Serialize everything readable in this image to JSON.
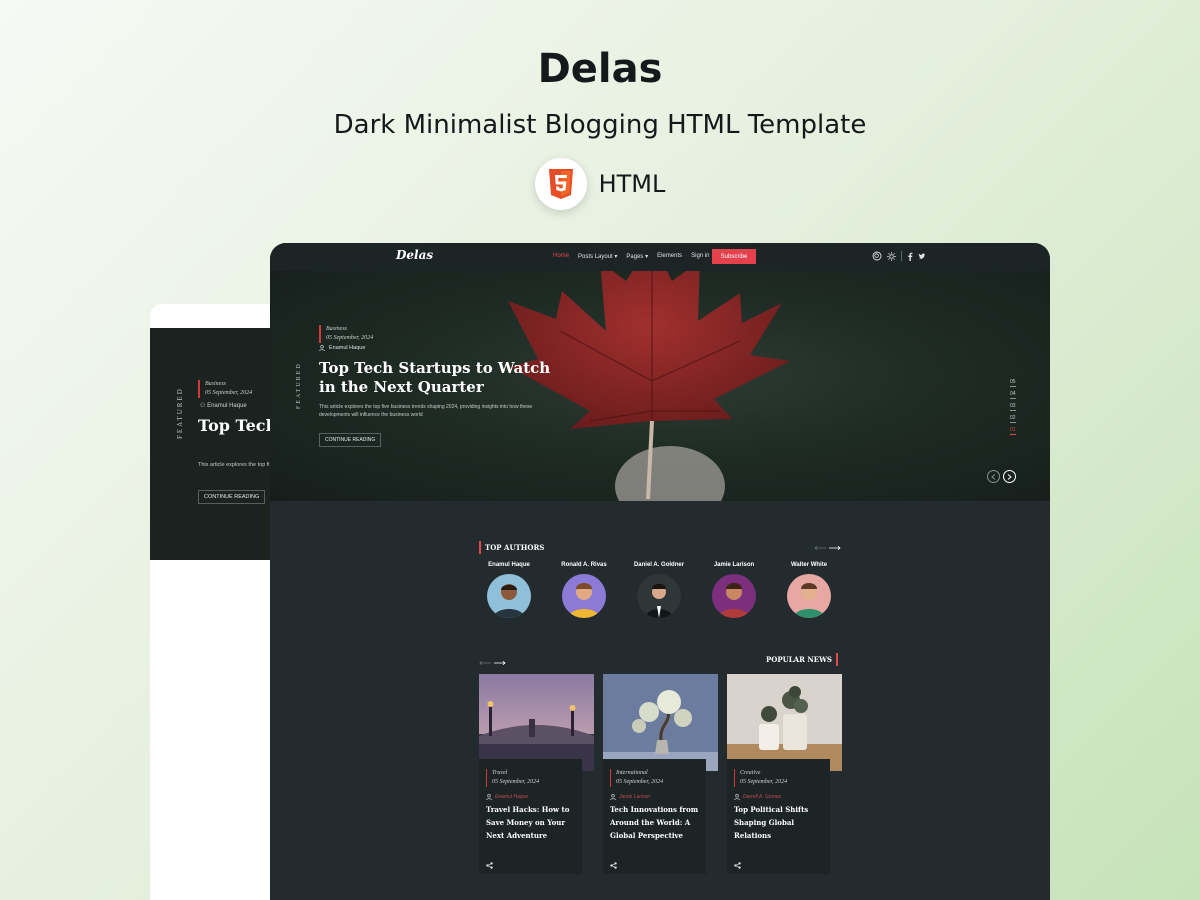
{
  "promo": {
    "title": "Delas",
    "subtitle": "Dark Minimalist Blogging HTML Template",
    "badge_label": "HTML",
    "badge_icon": "html5-icon",
    "brand_orange": "#e44d26"
  },
  "nav": {
    "logo": "Delas",
    "links": [
      "Home",
      "Posts Layout ▾",
      "Pages ▾",
      "Elements",
      "Sign in"
    ],
    "active_link": "Home",
    "subscribe_label": "Subscribe",
    "accent": "#e4414c",
    "icons": [
      "search-icon",
      "brightness-icon",
      "facebook-icon",
      "twitter-icon"
    ]
  },
  "featured_post": {
    "featured_label": "FEATURED",
    "category": "Business",
    "date": "05 September, 2024",
    "author": "Enamul Haque",
    "title": "Top Tech Startups to Watch in the Next Quarter",
    "description": "This article explores the top five business trends shaping 2024, providing insights into how these developments will influence the business world",
    "button_label": "CONTINUE READING",
    "pager": [
      "05",
      "04",
      "03",
      "02",
      "01"
    ],
    "pager_current": "01"
  },
  "back_preview": {
    "featured_label": "FEATURED",
    "category": "Business",
    "date": "05 September, 2024",
    "author": "Enamul Haque",
    "title": "Top Tech the Next Q",
    "description": "This article explores the top fi developments will influence th",
    "button_label": "CONTINUE READING"
  },
  "top_authors": {
    "heading": "TOP AUTHORS",
    "authors": [
      {
        "name": "Enamul Haque",
        "bg": "#8fbfd9"
      },
      {
        "name": "Ronald A. Rivas",
        "bg": "#8b7ad6"
      },
      {
        "name": "Daniel A. Goldner",
        "bg": "#2f3638"
      },
      {
        "name": "Jamie Larison",
        "bg": "#7b2f7c"
      },
      {
        "name": "Walter White",
        "bg": "#e7a7a3"
      }
    ]
  },
  "popular_news": {
    "heading": "POPULAR NEWS",
    "cards": [
      {
        "category": "Travel",
        "date": "05 September, 2024",
        "author": "Enamul Haque",
        "title": "Travel Hacks: How to Save Money on Your Next Adventure"
      },
      {
        "category": "International",
        "date": "05 September, 2024",
        "author": "Jamie Larison",
        "title": "Tech Innovations from Around the World: A Global Perspective"
      },
      {
        "category": "Creative",
        "date": "05 September, 2024",
        "author": "Darrell A. Gomez",
        "title": "Top Political Shifts Shaping Global Relations"
      }
    ]
  }
}
